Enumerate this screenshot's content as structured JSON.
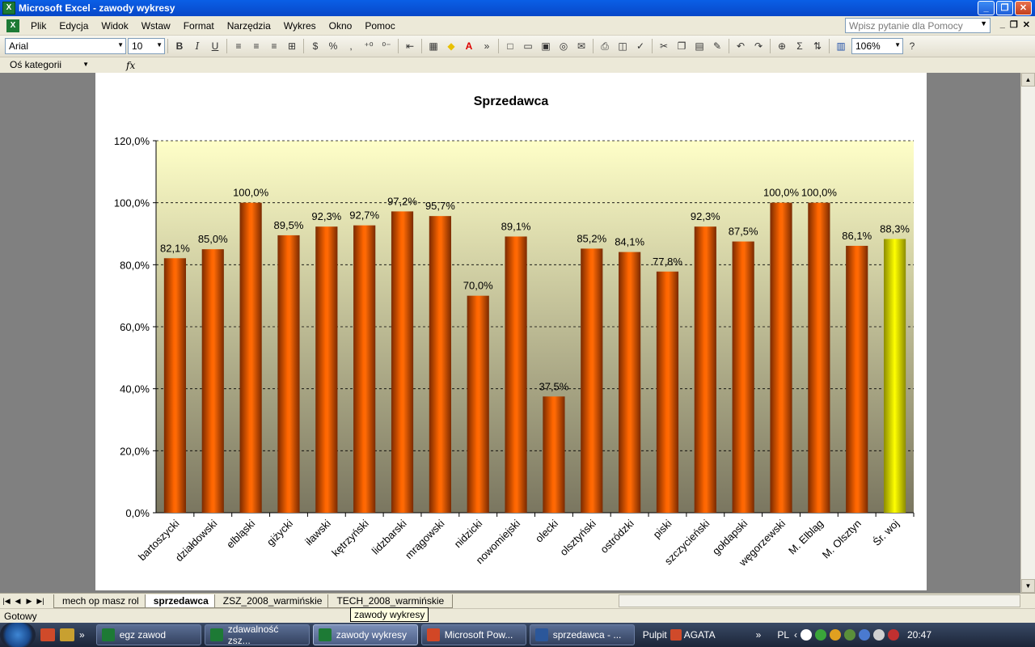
{
  "window": {
    "title": "Microsoft Excel - zawody wykresy",
    "app_icon": "excel-icon",
    "minimize_glyph": "_",
    "maximize_glyph": "❐",
    "close_glyph": "✕"
  },
  "menu": {
    "items": [
      "Plik",
      "Edycja",
      "Widok",
      "Wstaw",
      "Format",
      "Narzędzia",
      "Wykres",
      "Okno",
      "Pomoc"
    ],
    "help_placeholder": "Wpisz pytanie dla Pomocy"
  },
  "toolbar": {
    "font_name": "Arial",
    "font_size": "10",
    "bold": "B",
    "italic": "I",
    "underline": "U",
    "percent": "%",
    "thousands": ",",
    "zoom": "106%"
  },
  "formula_bar": {
    "name_box": "Oś kategorii",
    "fx": "fx"
  },
  "chart_data": {
    "type": "bar",
    "title": "Sprzedawca",
    "categories": [
      "bartoszycki",
      "działdowski",
      "elbląski",
      "giżycki",
      "iławski",
      "kętrzyński",
      "lidzbarski",
      "mrągowski",
      "nidzicki",
      "nowomiejski",
      "olecki",
      "olsztyński",
      "ostródzki",
      "piski",
      "szczycieński",
      "gołdapski",
      "węgorzewski",
      "M. Elbląg",
      "M. Olsztyn",
      "Śr. woj"
    ],
    "values": [
      82.1,
      85.0,
      100.0,
      89.5,
      92.3,
      92.7,
      97.2,
      95.7,
      70.0,
      89.1,
      37.5,
      85.2,
      84.1,
      77.8,
      92.3,
      87.5,
      100.0,
      100.0,
      86.1,
      88.3
    ],
    "value_labels": [
      "82,1%",
      "85,0%",
      "100,0%",
      "89,5%",
      "92,3%",
      "92,7%",
      "97,2%",
      "95,7%",
      "70,0%",
      "89,1%",
      "37,5%",
      "85,2%",
      "84,1%",
      "77,8%",
      "92,3%",
      "87,5%",
      "100,0%",
      "100,0%",
      "86,1%",
      "88,3%"
    ],
    "yticks": [
      "0,0%",
      "20,0%",
      "40,0%",
      "60,0%",
      "80,0%",
      "100,0%",
      "120,0%"
    ],
    "ylim": [
      0,
      120
    ],
    "grid": true,
    "colors": {
      "bar": "#ff6600",
      "highlight": "#ffff00",
      "plot_top": "#ffffc8",
      "plot_bottom": "#7a7660"
    },
    "highlight_index": 19
  },
  "sheet_tabs": {
    "tabs": [
      "mech op masz rol",
      "sprzedawca",
      "ZSZ_2008_warmińskie",
      "TECH_2008_warmińskie"
    ],
    "active": "sprzedawca"
  },
  "status": {
    "text": "Gotowy",
    "tooltip": "zawody wykresy"
  },
  "taskbar": {
    "items": [
      "egz zawod",
      "zdawalność zsz...",
      "zawody wykresy",
      "Microsoft Pow...",
      "sprzedawca - ..."
    ],
    "active": "zawody wykresy",
    "pulpit": "Pulpit",
    "agata": "AGATA",
    "lang": "PL",
    "clock": "20:47"
  }
}
